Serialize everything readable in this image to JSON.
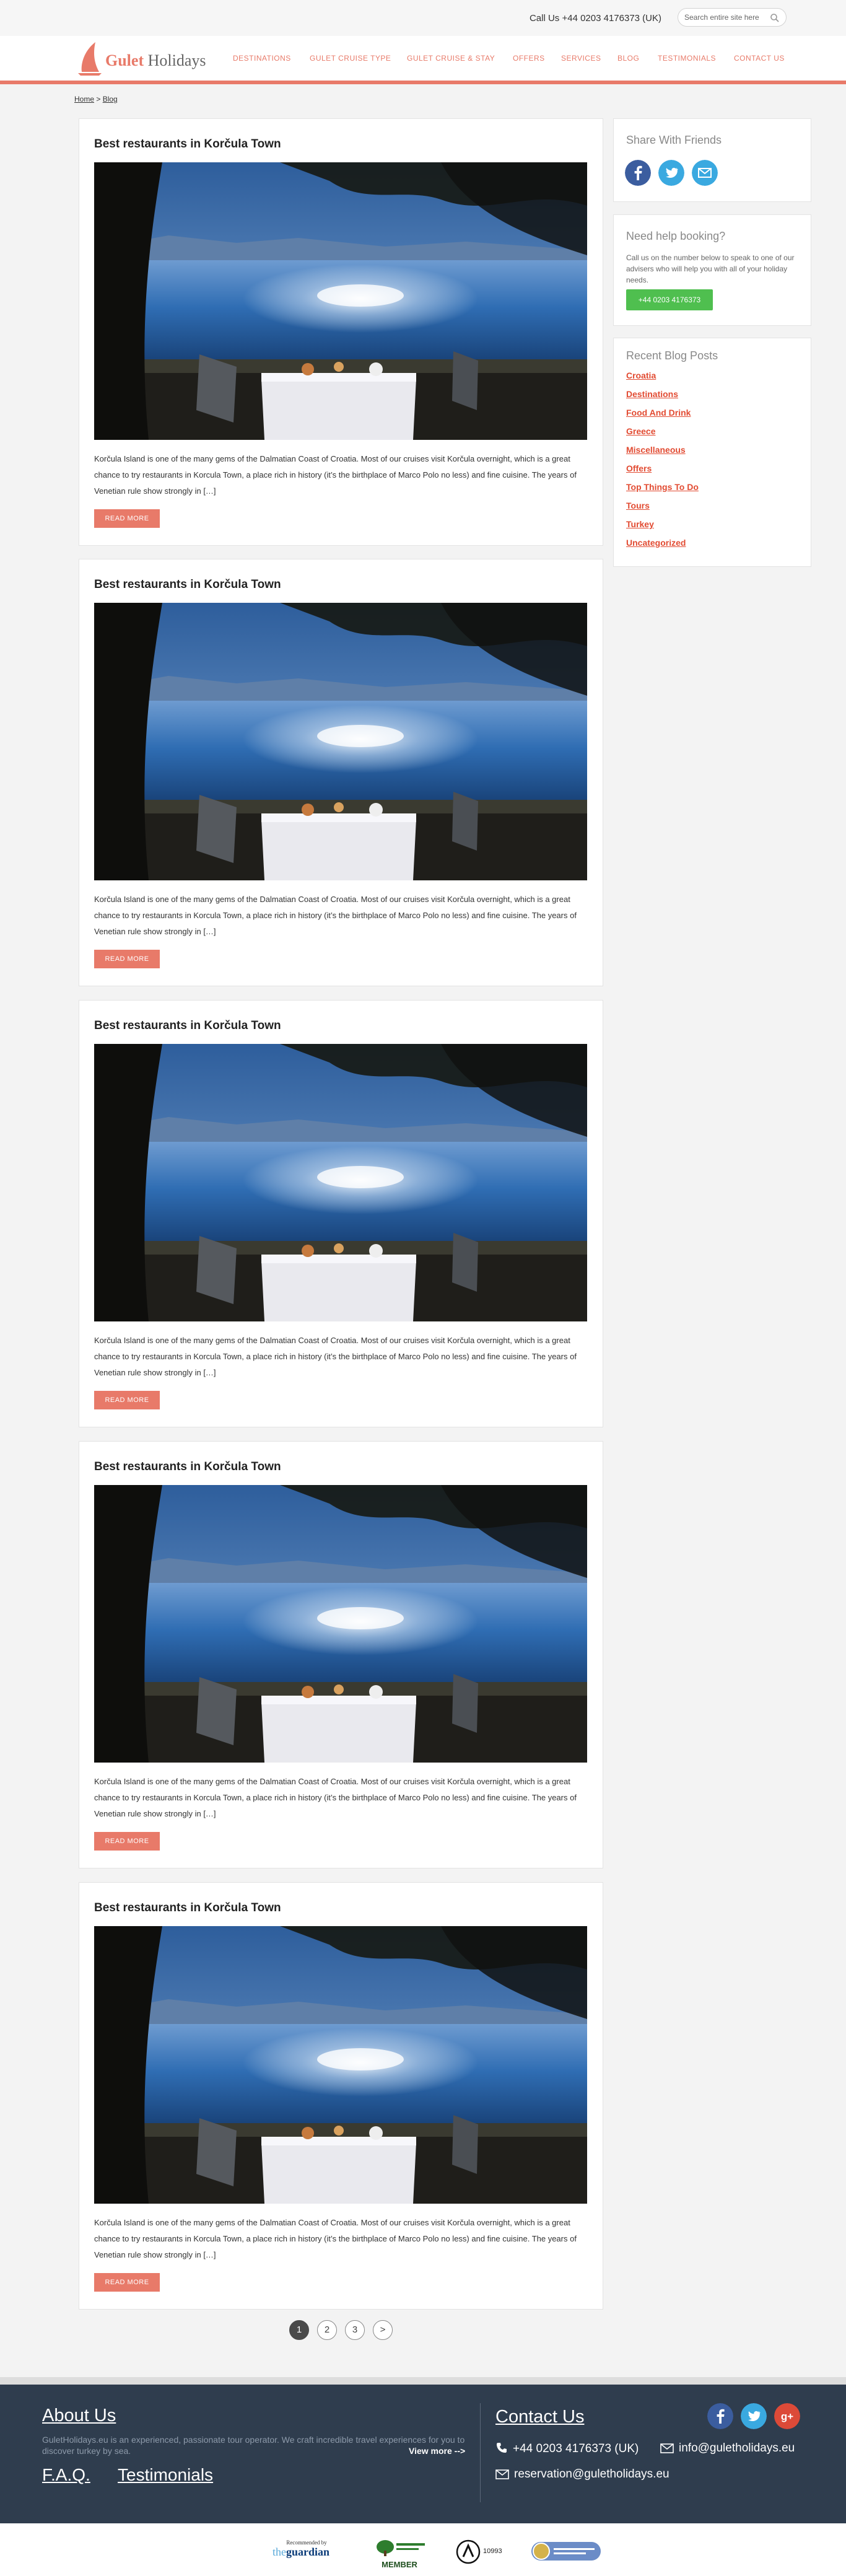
{
  "topbar": {
    "call_us": "Call Us +44 0203 4176373 (UK)",
    "search_placeholder": "Search entire site here"
  },
  "brand": {
    "name_part1": "Gulet",
    "name_part2": "Holidays",
    "accent_color": "#e87a69"
  },
  "nav": {
    "items": [
      {
        "label": "DESTINATIONS"
      },
      {
        "label": "GULET CRUISE TYPE"
      },
      {
        "label": "GULET CRUISE & STAY"
      },
      {
        "label": "OFFERS"
      },
      {
        "label": "SERVICES"
      },
      {
        "label": "BLOG"
      },
      {
        "label": "TESTIMONIALS"
      },
      {
        "label": "CONTACT US"
      }
    ]
  },
  "breadcrumb": {
    "home": "Home",
    "separator": " > ",
    "current": "Blog"
  },
  "posts": [
    {
      "title": "Best restaurants in Korčula Town",
      "excerpt": "Korčula Island is one of the many gems of the Dalmatian Coast of Croatia. Most of our cruises visit Korčula overnight, which is a great chance to try restaurants in Korcula Town, a place rich in history (it’s the birthplace of Marco Polo no less) and fine cuisine. The years of Venetian rule show strongly in […]",
      "read_more": "READ MORE"
    },
    {
      "title": "Best restaurants in Korčula Town",
      "excerpt": "Korčula Island is one of the many gems of the Dalmatian Coast of Croatia. Most of our cruises visit Korčula overnight, which is a great chance to try restaurants in Korcula Town, a place rich in history (it’s the birthplace of Marco Polo no less) and fine cuisine. The years of Venetian rule show strongly in […]",
      "read_more": "READ MORE"
    },
    {
      "title": "Best restaurants in Korčula Town",
      "excerpt": "Korčula Island is one of the many gems of the Dalmatian Coast of Croatia. Most of our cruises visit Korčula overnight, which is a great chance to try restaurants in Korcula Town, a place rich in history (it’s the birthplace of Marco Polo no less) and fine cuisine. The years of Venetian rule show strongly in […]",
      "read_more": "READ MORE"
    },
    {
      "title": "Best restaurants in Korčula Town",
      "excerpt": "Korčula Island is one of the many gems of the Dalmatian Coast of Croatia. Most of our cruises visit Korčula overnight, which is a great chance to try restaurants in Korcula Town, a place rich in history (it’s the birthplace of Marco Polo no less) and fine cuisine. The years of Venetian rule show strongly in […]",
      "read_more": "READ MORE"
    },
    {
      "title": "Best restaurants in Korčula Town",
      "excerpt": "Korčula Island is one of the many gems of the Dalmatian Coast of Croatia. Most of our cruises visit Korčula overnight, which is a great chance to try restaurants in Korcula Town, a place rich in history (it’s the birthplace of Marco Polo no less) and fine cuisine. The years of Venetian rule show strongly in […]",
      "read_more": "READ MORE"
    }
  ],
  "pagination": {
    "pages": [
      "1",
      "2",
      "3"
    ],
    "current": "1",
    "next": ">"
  },
  "sidebar": {
    "share": {
      "title": "Share With Friends",
      "icons": [
        "facebook-icon",
        "twitter-icon",
        "email-icon"
      ]
    },
    "help": {
      "title": "Need help booking?",
      "text": "Call us on the number below to speak to one of our advisers who will help you with all of your holiday needs.",
      "button": "+44 0203 4176373",
      "button_color": "#4fbf4f"
    },
    "recent": {
      "title": "Recent Blog Posts",
      "categories": [
        "Croatia",
        "Destinations",
        "Food And Drink",
        "Greece",
        "Miscellaneous",
        "Offers",
        "Top Things To Do",
        "Tours",
        "Turkey",
        "Uncategorized"
      ]
    }
  },
  "footer": {
    "about_title": "About Us",
    "about_text": "GuletHolidays.eu is an experienced, passionate tour operator. We craft incredible travel experiences for you to discover turkey by sea.",
    "view_more": "View more -->",
    "faq": "F.A.Q.",
    "testimonials": "Testimonials",
    "contact_title": "Contact Us",
    "phone": "+44 0203 4176373 (UK)",
    "email_info": "info@guletholidays.eu",
    "email_reservation": "reservation@guletholidays.eu",
    "bg_color": "#2f3d4e"
  },
  "badges": {
    "guardian_recommended": "Recommended by",
    "guardian_the": "the",
    "guardian_name": "guardian",
    "member_label": "MEMBER",
    "abta_number": "10993"
  }
}
